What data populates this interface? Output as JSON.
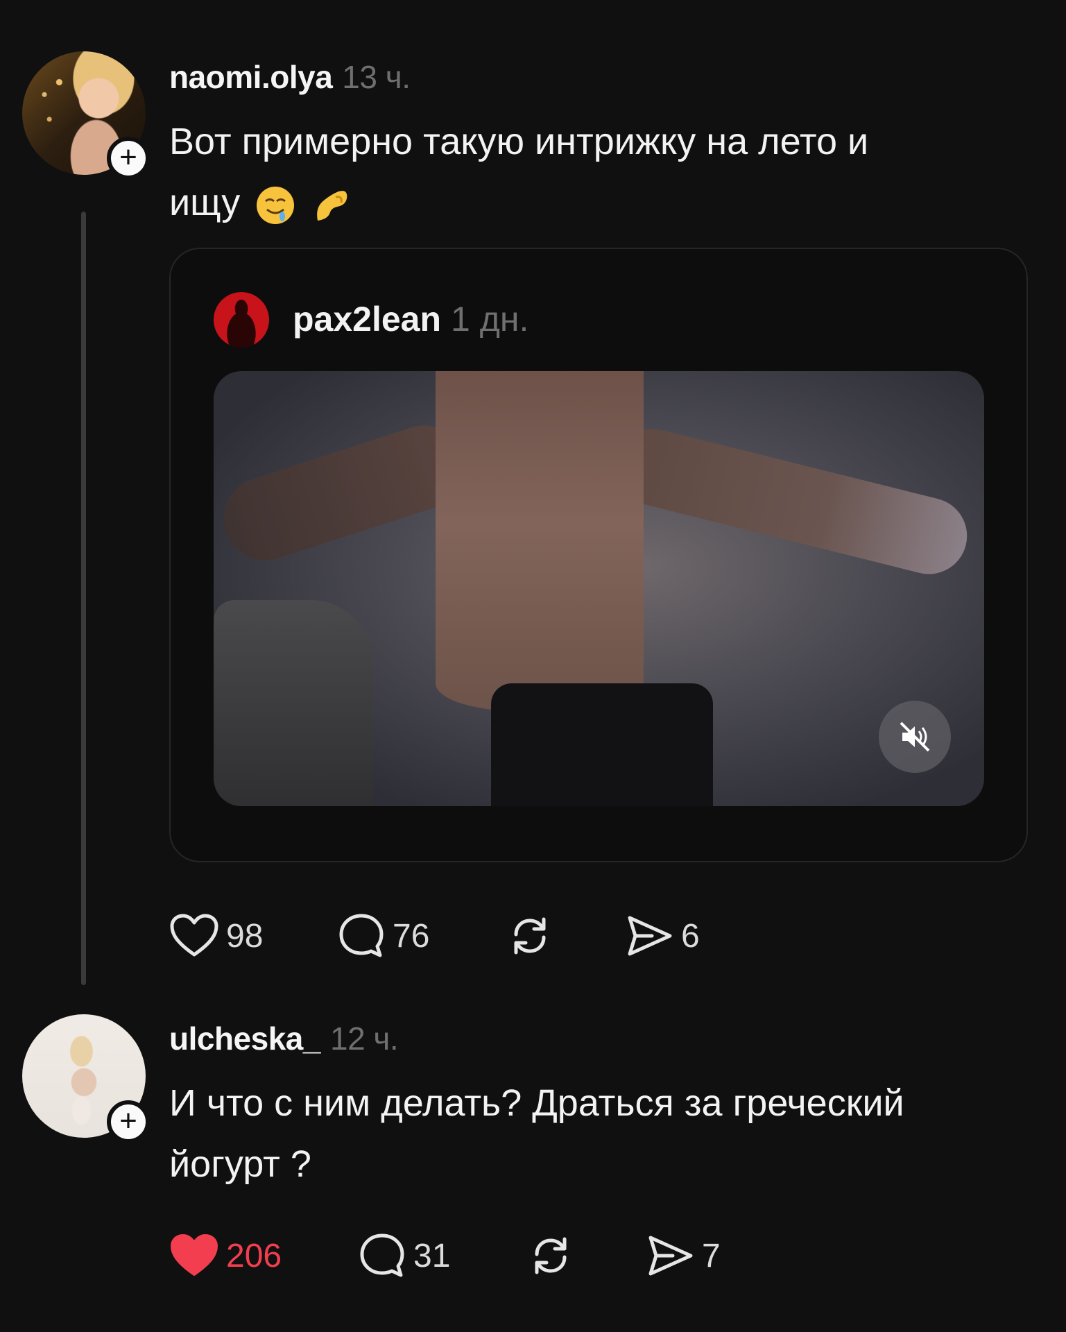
{
  "posts": [
    {
      "username": "naomi.olya",
      "time": "13 ч.",
      "text_line1": "Вот примерно такую интрижку на лето и",
      "text_line2": "ищу",
      "quote": {
        "username": "pax2lean",
        "time": "1 дн."
      },
      "actions": {
        "likes": "98",
        "comments": "76",
        "reposts": "",
        "shares": "6"
      }
    },
    {
      "username": "ulcheska_",
      "time": "12 ч.",
      "text_line1": "И что с ним делать? Драться за греческий",
      "text_line2": "йогурт ?",
      "actions": {
        "likes": "206",
        "comments": "31",
        "reposts": "",
        "shares": "7",
        "liked": true
      }
    }
  ],
  "icons": {
    "follow": "plus-icon",
    "like": "heart-icon",
    "comment": "comment-bubble-icon",
    "repost": "repost-icon",
    "share": "send-icon",
    "mute": "speaker-muted-icon"
  },
  "colors": {
    "background": "#101010",
    "like_active": "#f23e4f",
    "muted_text": "#6f6f6f"
  }
}
